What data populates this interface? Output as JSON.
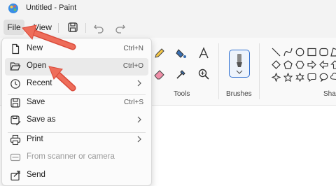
{
  "window": {
    "title": "Untitled - Paint"
  },
  "menubar": {
    "file_label": "File",
    "view_label": "View"
  },
  "ribbon": {
    "tools_label": "Tools",
    "brushes_label": "Brushes",
    "shapes_label": "Shap"
  },
  "file_menu": {
    "items": [
      {
        "label": "New",
        "shortcut": "Ctrl+N"
      },
      {
        "label": "Open",
        "shortcut": "Ctrl+O"
      },
      {
        "label": "Recent",
        "shortcut": ""
      },
      {
        "label": "Save",
        "shortcut": "Ctrl+S"
      },
      {
        "label": "Save as",
        "shortcut": ""
      },
      {
        "label": "Print",
        "shortcut": ""
      },
      {
        "label": "From scanner or camera",
        "shortcut": ""
      },
      {
        "label": "Send",
        "shortcut": ""
      }
    ]
  },
  "colors": {
    "accent": "#2f6fd0",
    "highlight": "#eaeaea",
    "annotation_arrow": "#e8604c"
  }
}
